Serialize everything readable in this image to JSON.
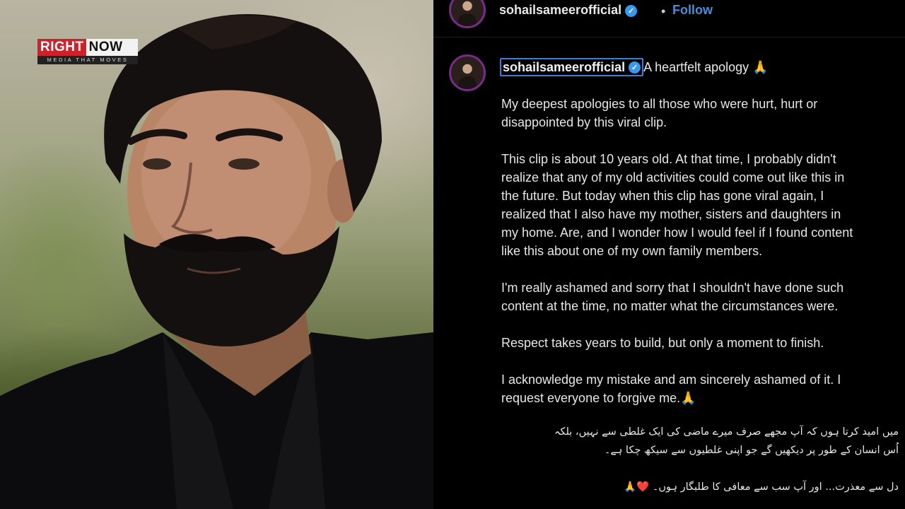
{
  "brand": {
    "name_part1": "RIGHT",
    "name_part2": "NOW",
    "tagline": "MEDIA THAT MOVES",
    "red": "#d0202a"
  },
  "post": {
    "username": "sohailsameerofficial",
    "verified_icon": "verified-badge-icon",
    "follow_label": "Follow",
    "separator": "•",
    "caption_title": "A heartfelt apology 🙏",
    "paragraphs": [
      [
        "My deepest apologies to all those who were hurt, hurt or",
        "disappointed by this viral clip."
      ],
      [
        "This clip is about 10 years old. At that time, I probably didn't",
        "realize that any of my old activities could come out like this in",
        "the future. But today when this clip has gone viral again, I",
        "realized that I also have my mother, sisters and daughters in",
        "my home. Are, and I wonder how I would feel if I found content",
        "like this about one of my own family members."
      ],
      [
        "I'm really ashamed and sorry that I shouldn't have done such",
        "content at the time, no matter what the circumstances were."
      ],
      [
        "Respect takes years to build, but only a moment to finish."
      ],
      [
        "I acknowledge my mistake and am sincerely ashamed of it. I",
        "request everyone to forgive me.🙏"
      ]
    ],
    "urdu_lines": [
      "میں امید کرتا ہوں کہ آپ مجھے صرف میرے ماضی کی ایک غلطی سے نہیں، بلکہ",
      "اُس انسان کے طور پر دیکھیں گے جو اپنی غلطیوں سے سیکھ چکا ہے۔",
      "دل سے معذرت... اور آپ سب سے معافی کا طلبگار ہوں۔ ❤️🙏"
    ]
  },
  "colors": {
    "accent_blue": "#3d7dd8",
    "follow_blue": "#4a8ed8",
    "panel_bg": "#000000"
  }
}
